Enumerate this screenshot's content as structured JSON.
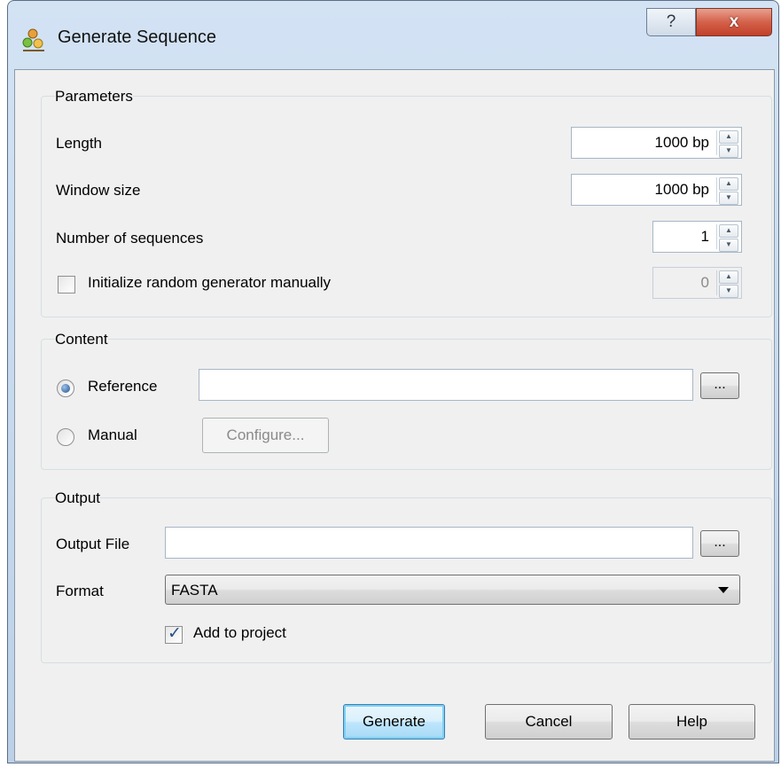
{
  "window": {
    "title": "Generate Sequence",
    "help_glyph": "?",
    "close_glyph": "x"
  },
  "parameters": {
    "group_title": "Parameters",
    "length_label": "Length",
    "length_value": "1000 bp",
    "window_size_label": "Window size",
    "window_size_value": "1000 bp",
    "num_sequences_label": "Number of sequences",
    "num_sequences_value": "1",
    "init_random_label": "Initialize random generator manually",
    "init_random_checked": false,
    "seed_value": "0"
  },
  "content": {
    "group_title": "Content",
    "reference_label": "Reference",
    "reference_value": "",
    "browse_label": "...",
    "manual_label": "Manual",
    "configure_label": "Configure..."
  },
  "output": {
    "group_title": "Output",
    "output_file_label": "Output File",
    "output_file_value": "",
    "browse_label": "...",
    "format_label": "Format",
    "format_value": "FASTA",
    "add_to_project_label": "Add to project",
    "add_to_project_checked": true
  },
  "buttons": {
    "generate": "Generate",
    "cancel": "Cancel",
    "help": "Help"
  },
  "spin_glyphs": {
    "up": "▲",
    "down": "▼"
  },
  "check_glyph": "✓",
  "colors": {
    "title_gradient_top": "#d3e3f4",
    "close_button": "#c2402a",
    "dialog_bg": "#f0f0f0",
    "default_button": "#bee6fd"
  }
}
